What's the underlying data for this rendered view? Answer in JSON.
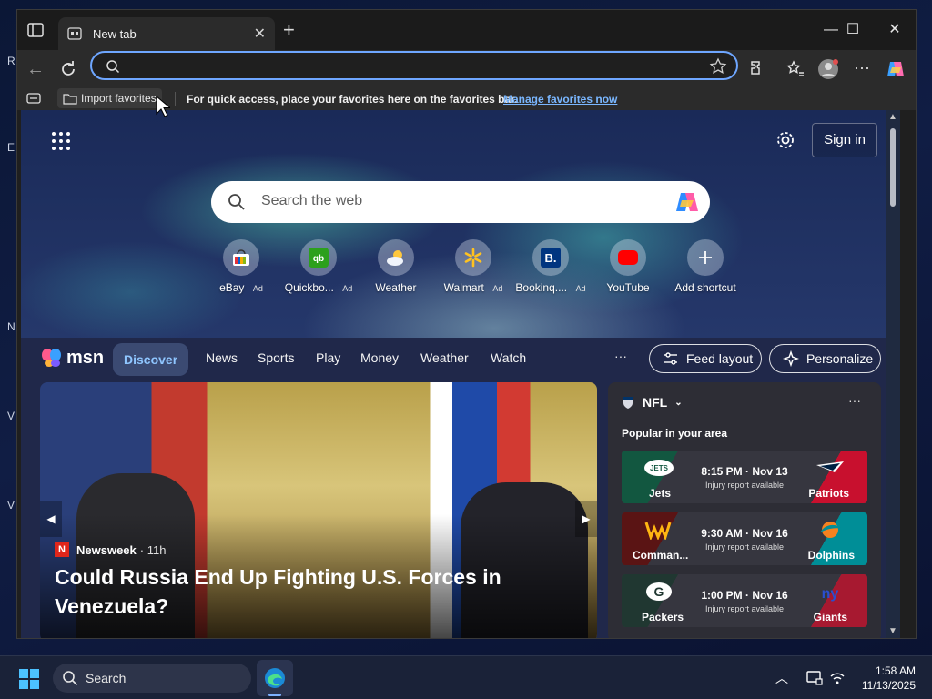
{
  "browser": {
    "tab_title": "New tab",
    "address_value": "",
    "favorites_bar": {
      "import_label": "Import favorites",
      "message": "For quick access, place your favorites here on the favorites bar.",
      "manage_link": "Manage favorites now"
    }
  },
  "newtab": {
    "signin_label": "Sign in",
    "search_placeholder": "Search the web",
    "shortcuts": [
      {
        "label": "eBay",
        "ad": "· Ad",
        "icon": "ebay-icon"
      },
      {
        "label": "Quickbo...",
        "ad": "· Ad",
        "icon": "quickbooks-icon"
      },
      {
        "label": "Weather",
        "ad": "",
        "icon": "weather-icon"
      },
      {
        "label": "Walmart",
        "ad": "· Ad",
        "icon": "walmart-icon"
      },
      {
        "label": "Bookinq....",
        "ad": "· Ad",
        "icon": "booking-icon"
      },
      {
        "label": "YouTube",
        "ad": "",
        "icon": "youtube-icon"
      },
      {
        "label": "Add shortcut",
        "ad": "",
        "icon": "plus-icon"
      }
    ]
  },
  "msn": {
    "logo_text": "msn",
    "tabs": [
      "Discover",
      "News",
      "Sports",
      "Play",
      "Money",
      "Weather",
      "Watch"
    ],
    "more": "···",
    "feed_layout_label": "Feed layout",
    "personalize_label": "Personalize",
    "hero": {
      "source": "Newsweek",
      "age": "· 11h",
      "headline": "Could Russia End Up Fighting U.S. Forces in Venezuela?"
    },
    "nfl": {
      "title": "NFL",
      "popular_label": "Popular in your area",
      "games": [
        {
          "home": "Jets",
          "away": "Patriots",
          "time": "8:15 PM · Nov 13",
          "note": "Injury report available",
          "home_color": "#125740",
          "away_color": "#c8102e"
        },
        {
          "home": "Comman...",
          "away": "Dolphins",
          "time": "9:30 AM · Nov 16",
          "note": "Injury report available",
          "home_color": "#5a1414",
          "away_color": "#008e97"
        },
        {
          "home": "Packers",
          "away": "Giants",
          "time": "1:00 PM · Nov 16",
          "note": "Injury report available",
          "home_color": "#203731",
          "away_color": "#a71930"
        }
      ]
    }
  },
  "taskbar": {
    "search_label": "Search",
    "time": "1:58 AM",
    "date": "11/13/2025"
  },
  "colors": {
    "accent": "#6ea6ff",
    "link": "#7ab7ff",
    "msn_active": "#8fc6ff"
  }
}
